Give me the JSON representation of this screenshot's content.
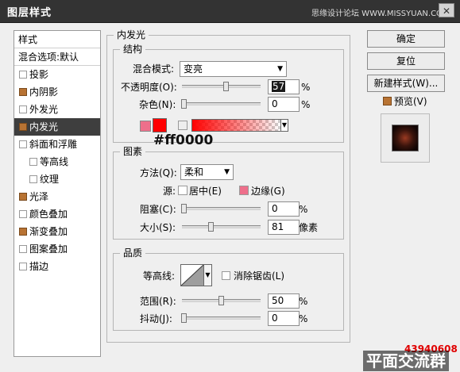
{
  "window": {
    "title": "图层样式",
    "site": "思缘设计论坛 WWW.MISSYUAN.COM",
    "close": "✕"
  },
  "stylelist": {
    "header": "样式",
    "blend": "混合选项:默认",
    "items": [
      {
        "label": "投影",
        "checked": false
      },
      {
        "label": "内阴影",
        "checked": true
      },
      {
        "label": "外发光",
        "checked": false
      },
      {
        "label": "内发光",
        "checked": true,
        "selected": true
      },
      {
        "label": "斜面和浮雕",
        "checked": false
      },
      {
        "label": "等高线",
        "checked": false,
        "sub": true
      },
      {
        "label": "纹理",
        "checked": false,
        "sub": true
      },
      {
        "label": "光泽",
        "checked": true
      },
      {
        "label": "颜色叠加",
        "checked": false
      },
      {
        "label": "渐变叠加",
        "checked": true
      },
      {
        "label": "图案叠加",
        "checked": false
      },
      {
        "label": "描边",
        "checked": false
      }
    ]
  },
  "inner_glow": {
    "title": "内发光",
    "structure": {
      "title": "结构",
      "blend_mode_label": "混合模式:",
      "blend_mode_value": "变亮",
      "opacity_label": "不透明度(O):",
      "opacity_value": "57",
      "opacity_unit": "%",
      "opacity_level": 0.57,
      "noise_label": "杂色(N):",
      "noise_value": "0",
      "noise_unit": "%",
      "color_note": "#ff0000"
    },
    "elements": {
      "title": "图素",
      "method_label": "方法(Q):",
      "method_value": "柔和",
      "source_label": "源:",
      "center_label": "居中(E)",
      "edge_label": "边缘(G)",
      "choke_label": "阻塞(C):",
      "choke_value": "0",
      "choke_unit": "%",
      "size_label": "大小(S):",
      "size_value": "81",
      "size_unit": "像素"
    },
    "quality": {
      "title": "品质",
      "contour_label": "等高线:",
      "antialias_label": "消除锯齿(L)",
      "range_label": "范围(R):",
      "range_value": "50",
      "range_unit": "%",
      "jitter_label": "抖动(J):",
      "jitter_value": "0",
      "jitter_unit": "%"
    }
  },
  "buttons": {
    "ok": "确定",
    "reset": "复位",
    "new_style": "新建样式(W)...",
    "preview": "预览(V)"
  },
  "watermark": {
    "number": "43940608",
    "text": "平面交流群"
  },
  "colors": {
    "glow": "#ff0000",
    "edge_swatch": "#ee6f8b",
    "checked": "#b87333",
    "selected_row": "#3e3e3e"
  }
}
